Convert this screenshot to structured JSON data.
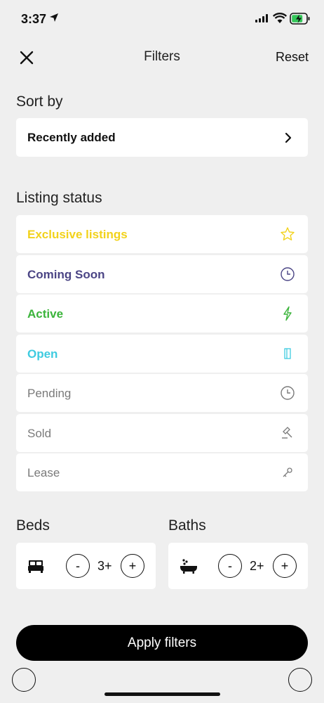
{
  "status_bar": {
    "time": "3:37"
  },
  "header": {
    "title": "Filters",
    "reset_label": "Reset"
  },
  "sort": {
    "section_title": "Sort by",
    "selected": "Recently added"
  },
  "listing_status": {
    "section_title": "Listing status",
    "items": [
      {
        "label": "Exclusive listings",
        "color": "#f2d21b",
        "icon": "star-icon"
      },
      {
        "label": "Coming Soon",
        "color": "#4b4585",
        "icon": "clock-icon"
      },
      {
        "label": "Active",
        "color": "#3bb43b",
        "icon": "lightning-icon"
      },
      {
        "label": "Open",
        "color": "#3ecbe0",
        "icon": "door-icon"
      },
      {
        "label": "Pending",
        "color": "#7a7a7a",
        "icon": "clock-icon"
      },
      {
        "label": "Sold",
        "color": "#7a7a7a",
        "icon": "gavel-icon"
      },
      {
        "label": "Lease",
        "color": "#7a7a7a",
        "icon": "key-icon"
      }
    ]
  },
  "beds": {
    "section_title": "Beds",
    "value": "3+",
    "minus": "-",
    "plus": "+",
    "icon": "bed-icon"
  },
  "baths": {
    "section_title": "Baths",
    "value": "2+",
    "minus": "-",
    "plus": "+",
    "icon": "bathtub-icon"
  },
  "apply_label": "Apply filters"
}
